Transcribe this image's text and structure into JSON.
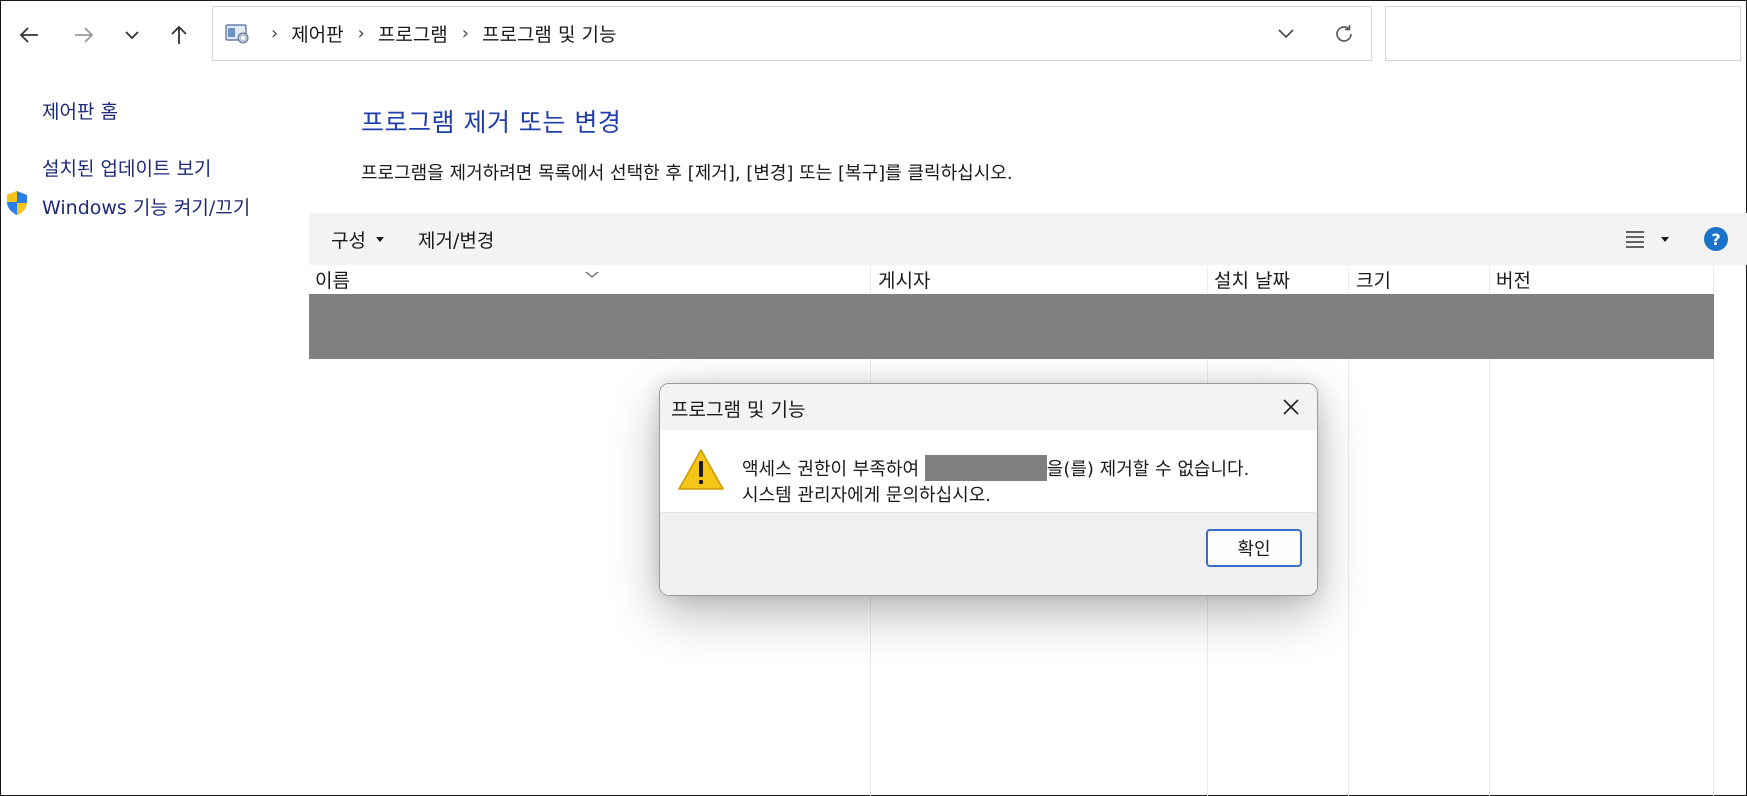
{
  "nav": {
    "back_icon": "back-arrow-icon",
    "forward_icon": "forward-arrow-icon",
    "recent_icon": "chevron-down-icon",
    "up_icon": "up-arrow-icon"
  },
  "address": {
    "crumbs": [
      "제어판",
      "프로그램",
      "프로그램 및 기능"
    ],
    "separator": "›"
  },
  "sidebar": {
    "home": "제어판 홈",
    "updates": "설치된 업데이트 보기",
    "features": "Windows 기능 켜기/끄기"
  },
  "main": {
    "title": "프로그램 제거 또는 변경",
    "description": "프로그램을 제거하려면 목록에서 선택한 후 [제거], [변경] 또는 [복구]를 클릭하십시오."
  },
  "toolbar": {
    "organize": "구성",
    "uninstall_change": "제거/변경"
  },
  "columns": [
    "이름",
    "게시자",
    "설치 날짜",
    "크기",
    "버전"
  ],
  "dialog": {
    "title": "프로그램 및 기능",
    "message_line1_before": "액세스 권한이 부족하여 ",
    "message_line1_after": "을(를) 제거할 수 없습니다.",
    "message_line2": "시스템 관리자에게 문의하십시오.",
    "ok_label": "확인"
  },
  "colors": {
    "link_blue": "#1e2a78",
    "title_blue": "#1e3faa",
    "help_blue": "#1a73c8",
    "warning_yellow": "#f5c518"
  }
}
